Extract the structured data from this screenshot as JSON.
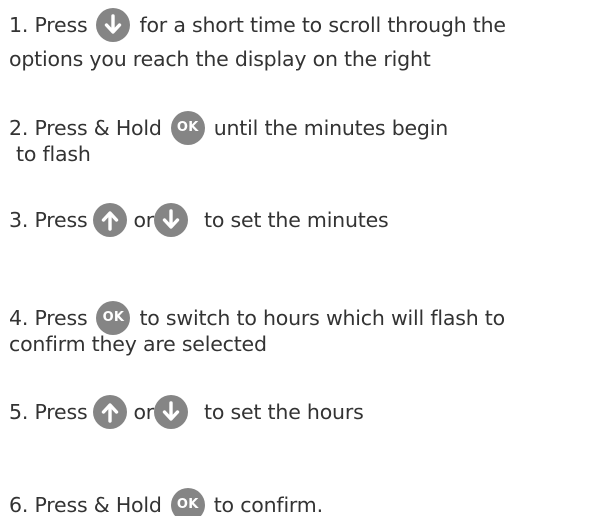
{
  "steps": [
    {
      "before": "1. Press",
      "button1": "arrow-down",
      "after": "for a short time to scroll through the",
      "line2": "options you reach the display on the right"
    },
    {
      "before": "2. Press & Hold",
      "button1_label": "OK",
      "after": "until the minutes begin",
      "line2": "to flash"
    },
    {
      "before": "3. Press",
      "button1": "arrow-up",
      "middle": "or",
      "button2": "arrow-down",
      "after": "to set the minutes"
    },
    {
      "before": "4. Press",
      "button1_label": "OK",
      "after": "to switch to hours which will flash to",
      "line2": "confirm they are selected"
    },
    {
      "before": "5. Press",
      "button1": "arrow-up",
      "middle": "or",
      "button2": "arrow-down",
      "after": "to set the hours"
    },
    {
      "before": "6. Press & Hold",
      "button1_label": "OK",
      "after": "to confirm."
    }
  ],
  "colors": {
    "text": "#333333",
    "button": "#858585",
    "button_text": "#ffffff"
  }
}
